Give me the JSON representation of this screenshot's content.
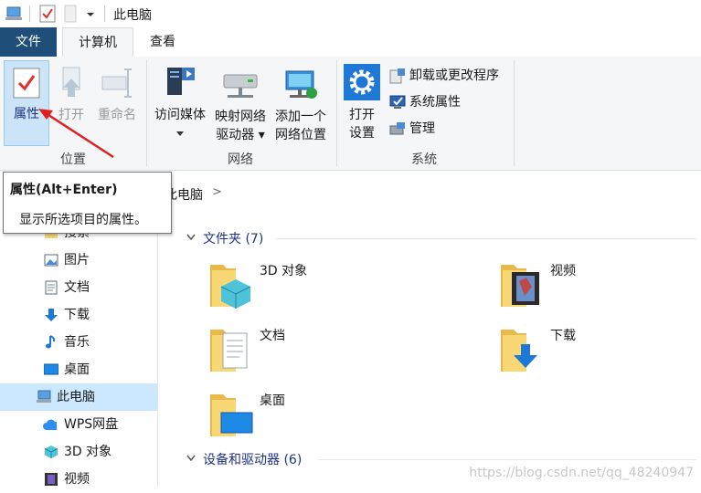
{
  "titlebar": {
    "title": "此电脑"
  },
  "tabs": {
    "file": "文件",
    "computer": "计算机",
    "view": "查看"
  },
  "ribbon": {
    "location": {
      "properties": "属性",
      "open": "打开",
      "rename": "重命名",
      "group": "位置"
    },
    "network": {
      "access_media": "访问媒体",
      "map_drive_1": "映射网络",
      "map_drive_2": "驱动器",
      "add_location_1": "添加一个",
      "add_location_2": "网络位置",
      "group": "网络"
    },
    "system": {
      "open_settings_1": "打开",
      "open_settings_2": "设置",
      "uninstall": "卸载或更改程序",
      "sys_props": "系统属性",
      "manage": "管理",
      "group": "系统"
    }
  },
  "address": {
    "crumb": "此电脑",
    "chevron": ">"
  },
  "tooltip": {
    "title": "属性(Alt+Enter)",
    "desc": "显示所选项目的属性。"
  },
  "nav": {
    "items": [
      {
        "label": "搜索",
        "icon": "search-folder-icon"
      },
      {
        "label": "图片",
        "icon": "pictures-icon"
      },
      {
        "label": "文档",
        "icon": "documents-icon"
      },
      {
        "label": "下载",
        "icon": "download-arrow-icon"
      },
      {
        "label": "音乐",
        "icon": "music-note-icon"
      },
      {
        "label": "桌面",
        "icon": "desktop-icon"
      },
      {
        "label": "此电脑",
        "icon": "this-pc-icon"
      },
      {
        "label": "WPS网盘",
        "icon": "cloud-icon"
      },
      {
        "label": "3D 对象",
        "icon": "cube-icon"
      },
      {
        "label": "视频",
        "icon": "video-icon"
      }
    ]
  },
  "content": {
    "folders_header": "文件夹 (7)",
    "devices_header": "设备和驱动器 (6)",
    "folders": [
      {
        "label": "3D 对象",
        "overlay": "cube"
      },
      {
        "label": "视频",
        "overlay": "film"
      },
      {
        "label": "文档",
        "overlay": "doc"
      },
      {
        "label": "下载",
        "overlay": "download"
      },
      {
        "label": "桌面",
        "overlay": "desktop"
      }
    ]
  },
  "watermark": "https://blog.csdn.net/qq_48240947",
  "colors": {
    "accent": "#1f4f78",
    "selected": "#cce8ff",
    "folder": "#f8d775",
    "folder_dark": "#e8b84a",
    "arrow_red": "#e02020"
  }
}
